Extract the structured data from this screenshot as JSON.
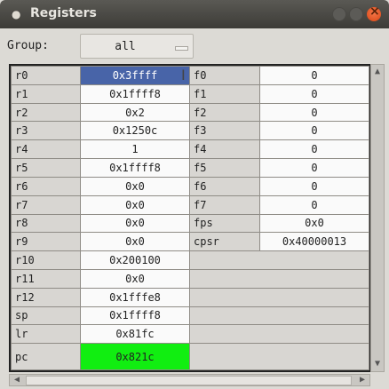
{
  "window": {
    "title": "Registers",
    "title_glyph": "●"
  },
  "group": {
    "label": "Group:",
    "value": "all"
  },
  "rows": [
    {
      "n1": "r0",
      "v1": "0x3ffff",
      "n2": "f0",
      "v2": "0"
    },
    {
      "n1": "r1",
      "v1": "0x1ffff8",
      "n2": "f1",
      "v2": "0"
    },
    {
      "n1": "r2",
      "v1": "0x2",
      "n2": "f2",
      "v2": "0"
    },
    {
      "n1": "r3",
      "v1": "0x1250c",
      "n2": "f3",
      "v2": "0"
    },
    {
      "n1": "r4",
      "v1": "1",
      "n2": "f4",
      "v2": "0"
    },
    {
      "n1": "r5",
      "v1": "0x1ffff8",
      "n2": "f5",
      "v2": "0"
    },
    {
      "n1": "r6",
      "v1": "0x0",
      "n2": "f6",
      "v2": "0"
    },
    {
      "n1": "r7",
      "v1": "0x0",
      "n2": "f7",
      "v2": "0"
    },
    {
      "n1": "r8",
      "v1": "0x0",
      "n2": "fps",
      "v2": "0x0"
    },
    {
      "n1": "r9",
      "v1": "0x0",
      "n2": "cpsr",
      "v2": "0x40000013"
    },
    {
      "n1": "r10",
      "v1": "0x200100"
    },
    {
      "n1": "r11",
      "v1": "0x0"
    },
    {
      "n1": "r12",
      "v1": "0x1fffe8"
    },
    {
      "n1": "sp",
      "v1": "0x1ffff8"
    },
    {
      "n1": "lr",
      "v1": "0x81fc"
    },
    {
      "n1": "pc",
      "v1": "0x821c"
    }
  ],
  "colors": {
    "selected": "#4864a8",
    "changed": "#11ee11"
  },
  "icons": {
    "cursor": "text-cursor-icon",
    "up": "arrow-up-icon",
    "down": "arrow-down-icon",
    "left": "arrow-left-icon",
    "right": "arrow-right-icon"
  }
}
